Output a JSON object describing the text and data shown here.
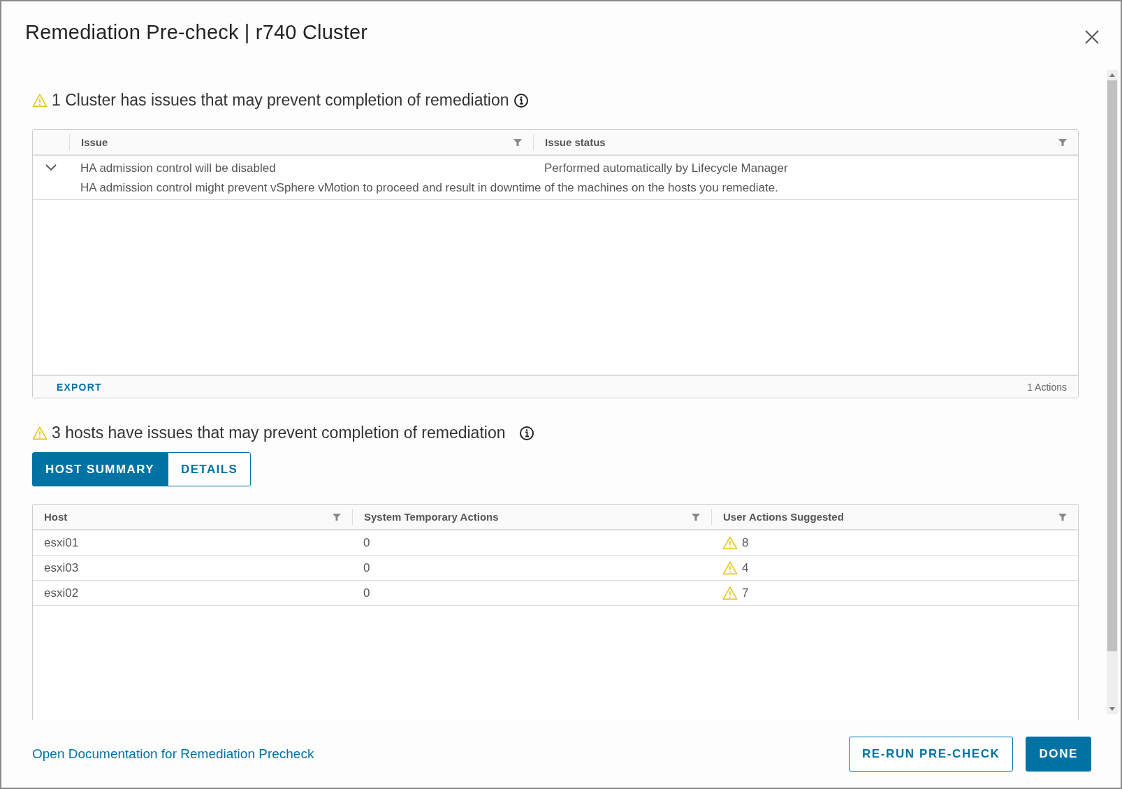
{
  "dialog": {
    "title": "Remediation Pre-check | r740 Cluster"
  },
  "cluster_section": {
    "heading": "1 Cluster has issues that may prevent completion of remediation",
    "table": {
      "columns": [
        "Issue",
        "Issue status"
      ],
      "rows": [
        {
          "expanded": true,
          "issue": "HA admission control will be disabled",
          "status": "Performed automatically by Lifecycle Manager",
          "detail": "HA admission control might prevent vSphere vMotion to proceed and result in downtime of the machines on the hosts you remediate."
        }
      ],
      "footer": {
        "export": "EXPORT",
        "count": "1 Actions"
      }
    }
  },
  "hosts_section": {
    "heading": "3 hosts have issues that may prevent completion of remediation",
    "tabs": [
      {
        "label": "HOST SUMMARY",
        "selected": true
      },
      {
        "label": "DETAILS",
        "selected": false
      }
    ],
    "table": {
      "columns": [
        "Host",
        "System Temporary Actions",
        "User Actions Suggested"
      ],
      "rows": [
        {
          "host": "esxi01",
          "system_actions": "0",
          "user_actions": "8"
        },
        {
          "host": "esxi03",
          "system_actions": "0",
          "user_actions": "4"
        },
        {
          "host": "esxi02",
          "system_actions": "0",
          "user_actions": "7"
        }
      ]
    }
  },
  "footer": {
    "link": "Open Documentation for Remediation Precheck",
    "buttons": [
      {
        "label": "RE-RUN PRE-CHECK",
        "kind": "secondary"
      },
      {
        "label": "DONE",
        "kind": "primary"
      }
    ]
  }
}
